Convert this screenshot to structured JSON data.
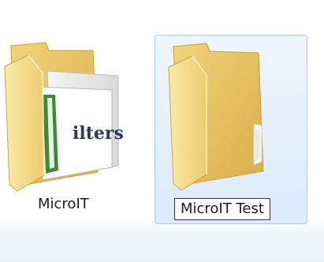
{
  "folders": [
    {
      "name": "MicroIT",
      "selected": false,
      "has_preview": true,
      "preview_text": "ilters"
    },
    {
      "name": "MicroIT Test",
      "selected": true,
      "renaming": true,
      "has_preview": false
    }
  ],
  "colors": {
    "folder_front": "#f7df8f",
    "folder_back": "#e7c462",
    "selection_fill": "#dcebfa",
    "selection_border": "#a7cdee",
    "preview_green": "#3f8a3a",
    "label_text": "#1c1c1c"
  },
  "icons": {
    "folder": "folder-icon",
    "preview": "document-preview-thumbnail"
  }
}
